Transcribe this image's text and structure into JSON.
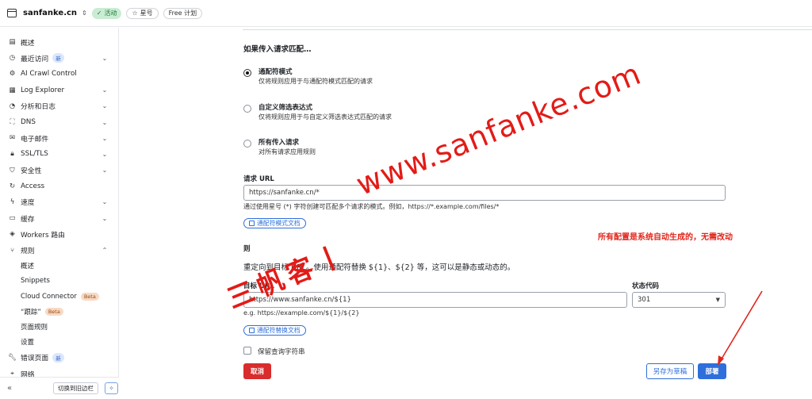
{
  "header": {
    "site_name": "sanfanke.cn",
    "status_pill": "活动",
    "star_pill": "星号",
    "plan_pill": "Free 计划"
  },
  "sidebar": {
    "items": [
      {
        "label": "概述",
        "icon": "document-icon"
      },
      {
        "label": "最近访问",
        "icon": "clock-icon",
        "badge": "新",
        "chevron": "down"
      },
      {
        "label": "AI Crawl Control",
        "icon": "robot-icon"
      },
      {
        "label": "Log Explorer",
        "icon": "log-icon",
        "chevron": "down"
      },
      {
        "label": "分析和日志",
        "icon": "chart-pie-icon",
        "chevron": "down"
      },
      {
        "label": "DNS",
        "icon": "network-icon",
        "chevron": "down"
      },
      {
        "label": "电子邮件",
        "icon": "mail-icon",
        "chevron": "down"
      },
      {
        "label": "SSL/TLS",
        "icon": "lock-icon",
        "chevron": "down"
      },
      {
        "label": "安全性",
        "icon": "shield-icon",
        "chevron": "down"
      },
      {
        "label": "Access",
        "icon": "refresh-icon"
      },
      {
        "label": "速度",
        "icon": "bolt-icon",
        "chevron": "down"
      },
      {
        "label": "缓存",
        "icon": "server-icon",
        "chevron": "down"
      },
      {
        "label": "Workers 路由",
        "icon": "workers-icon"
      },
      {
        "label": "规则",
        "icon": "rules-icon",
        "chevron": "up"
      }
    ],
    "sub_items": [
      {
        "label": "概述"
      },
      {
        "label": "Snippets"
      },
      {
        "label": "Cloud Connector",
        "badge": "Beta"
      },
      {
        "label": "“跟踪”",
        "badge": "Beta"
      },
      {
        "label": "页面规则"
      },
      {
        "label": "设置"
      }
    ],
    "items_after": [
      {
        "label": "错误页面",
        "icon": "wrench-icon",
        "badge": "新"
      },
      {
        "label": "网络",
        "icon": "pin-icon"
      }
    ],
    "footer": {
      "toggle_label": "切换到旧边栏"
    }
  },
  "form": {
    "section_title": "如果传入请求匹配…",
    "options": [
      {
        "title": "通配符模式",
        "desc": "仅将规则应用于与通配符模式匹配的请求",
        "checked": true
      },
      {
        "title": "自定义筛选表达式",
        "desc": "仅将规则应用于与自定义筛选表达式匹配的请求",
        "checked": false
      },
      {
        "title": "所有传入请求",
        "desc": "对所有请求应用规则",
        "checked": false
      }
    ],
    "request_url_label": "请求 URL",
    "request_url_value": "https://sanfanke.cn/*",
    "request_url_help": "通过使用星号 (*) 字符创建可匹配多个请求的模式。例如，https://*.example.com/files/*",
    "wildcard_doc_btn": "通配符模式文档",
    "then_label": "则",
    "redirect_desc": "重定向到目标 URL。使用通配符替换 ${1}、${2} 等，这可以是静态或动态的。",
    "target_url_label": "目标 URL",
    "target_url_value": "https://www.sanfanke.cn/${1}",
    "target_url_help": "e.g. https://example.com/${1}/${2}",
    "status_code_label": "状态代码",
    "status_code_value": "301",
    "replace_doc_btn": "通配符替换文档",
    "preserve_query_label": "保留查询字符串",
    "cancel_btn": "取消",
    "draft_btn": "另存为草稿",
    "deploy_btn": "部署"
  },
  "overlay": {
    "annotation": "所有配置是系统自动生成的，无需改动",
    "watermark_url": "www.sanfanke.com",
    "watermark_cn": "三帆客丨"
  },
  "colors": {
    "accent": "#2f6fdb",
    "danger": "#d92c2c",
    "annotation": "#e0261c",
    "active_pill_bg": "#c9ecd2"
  }
}
